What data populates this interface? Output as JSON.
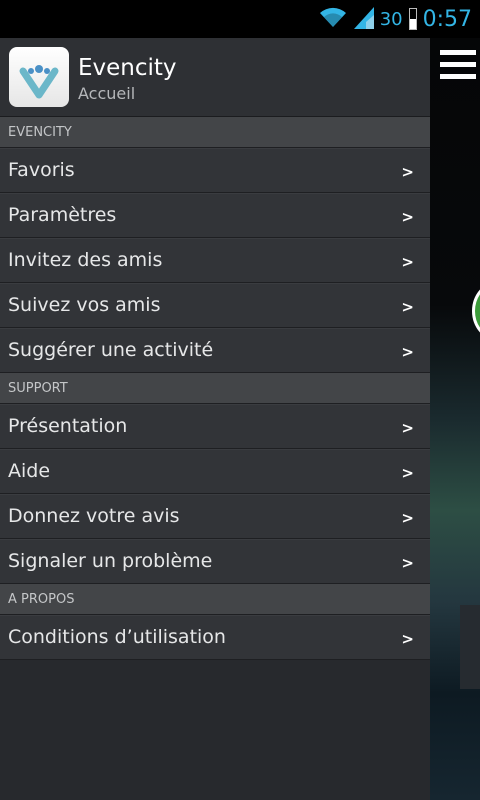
{
  "status_bar": {
    "signal_text": "30",
    "time": "0:57",
    "battery_level": 0.5
  },
  "header": {
    "app_name": "Evencity",
    "subtitle": "Accueil"
  },
  "sections": [
    {
      "title": "EVENCITY",
      "items": [
        "Favoris",
        "Paramètres",
        "Invitez des amis",
        "Suivez vos amis",
        "Suggérer une activité"
      ]
    },
    {
      "title": "SUPPORT",
      "items": [
        "Présentation",
        "Aide",
        "Donnez votre avis",
        "Signaler un problème"
      ]
    },
    {
      "title": "A PROPOS",
      "items": [
        "Conditions d’utilisation"
      ]
    }
  ],
  "icons": {
    "wifi": "wifi-icon",
    "signal": "signal-icon",
    "battery": "battery-icon",
    "menu": "hamburger-menu-icon",
    "chevron": "chevron-right-icon"
  },
  "colors": {
    "accent": "#33b5e5",
    "drawer_bg": "#27292d",
    "item_bg": "#323438",
    "section_bg": "#434548"
  }
}
